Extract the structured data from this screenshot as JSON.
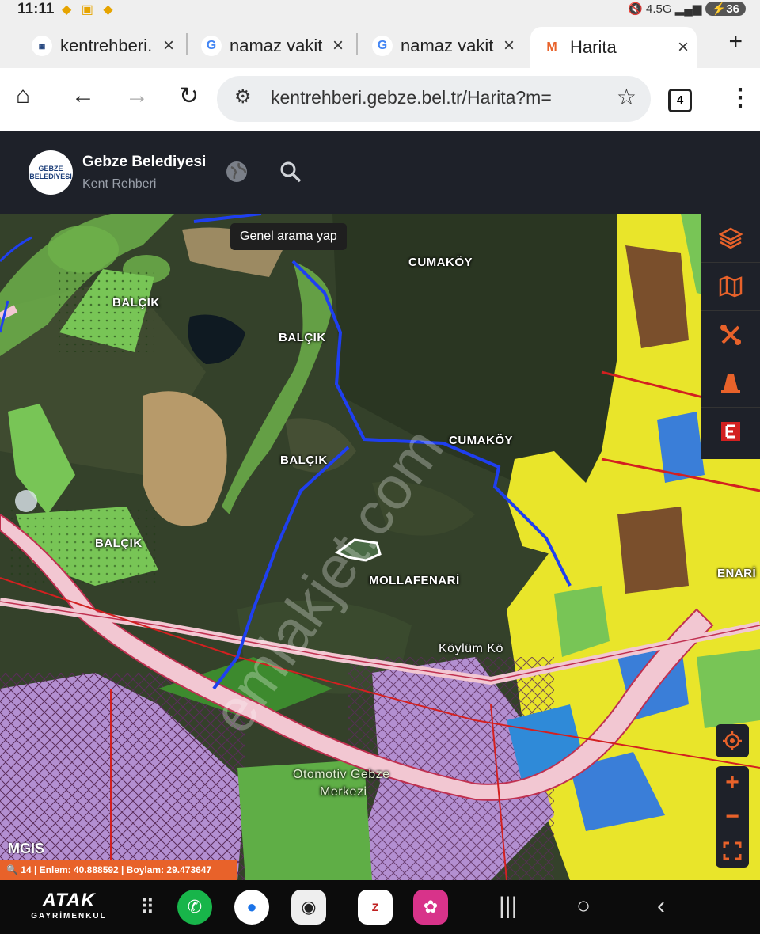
{
  "status": {
    "time": "11:11",
    "signal": "4.5G",
    "battery": "36"
  },
  "tabs": [
    {
      "title": "kentrehberi.",
      "fav": "G"
    },
    {
      "title": "namaz vakit",
      "fav": "G"
    },
    {
      "title": "namaz vakit",
      "fav": "G"
    },
    {
      "title": "Harita",
      "fav": "M"
    }
  ],
  "browser": {
    "url": "kentrehberi.gebze.bel.tr/Harita?m=",
    "tab_count": "4"
  },
  "app": {
    "name": "Gebze Belediyesi",
    "subtitle": "Kent Rehberi",
    "logo_text": "GEBZE BELEDİYESİ"
  },
  "tooltip": "Genel arama yap",
  "map": {
    "labels": {
      "cumakoy1": "CUMAKÖY",
      "balcik1": "BALÇIK",
      "balcik2": "BALÇIK",
      "balcik3": "BALÇIK",
      "balcik4": "BALÇIK",
      "cumakoy2": "CUMAKÖY",
      "mollafenari1": "MOLLAFENARİ",
      "mollafenari2": "ENARİ",
      "koylum": "Köylüm Kö",
      "otomotiv": "Otomotiv Gebze",
      "merkezi": "Merkezi"
    },
    "watermark": "emlakjet.com",
    "coords": "14 | Enlem: 40.888592 | Boylam: 29.473647",
    "gis_brand": "MGIS"
  },
  "side_tools": [
    "layers-icon",
    "map-icon",
    "tools-icon",
    "cone-icon",
    "e-icon"
  ],
  "brand": {
    "line1": "ATAK",
    "line2": "GAYRİMENKUL"
  },
  "colors": {
    "accent": "#e8622a",
    "header": "#1e2129",
    "boundary": "#1f3ff0",
    "residential": "#e9e52a",
    "industrial": "#b38fd1"
  }
}
